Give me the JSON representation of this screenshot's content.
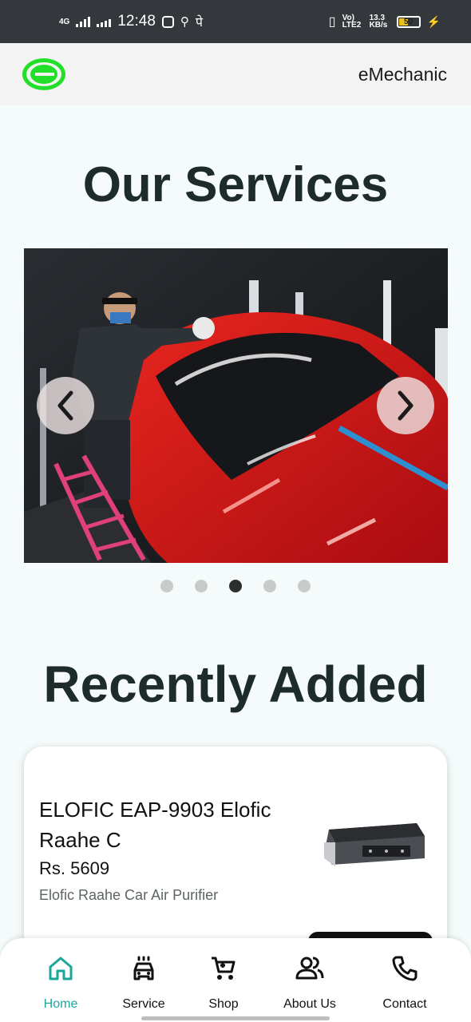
{
  "status_bar": {
    "network": "4G",
    "time": "12:48",
    "extra_glyph": "पे",
    "volte": "Vo) LTE2",
    "speed": "13.3 KB/s",
    "battery": "50"
  },
  "app_bar": {
    "title": "eMechanic"
  },
  "sections": {
    "services_title": "Our Services",
    "recent_title": "Recently Added"
  },
  "carousel": {
    "slide_count": 5,
    "active_index": 2
  },
  "product": {
    "name": "ELOFIC EAP-9903 Elofic Raahe C",
    "price": "Rs. 5609",
    "description": "Elofic Raahe Car Air Purifier"
  },
  "bottom_nav": {
    "items": [
      {
        "label": "Home",
        "icon": "home-icon"
      },
      {
        "label": "Service",
        "icon": "car-icon"
      },
      {
        "label": "Shop",
        "icon": "cart-icon"
      },
      {
        "label": "About Us",
        "icon": "people-icon"
      },
      {
        "label": "Contact",
        "icon": "phone-icon"
      }
    ],
    "active_index": 0
  },
  "colors": {
    "accent": "#1aa69a",
    "logo": "#22e02a",
    "car": "#d0121a"
  }
}
